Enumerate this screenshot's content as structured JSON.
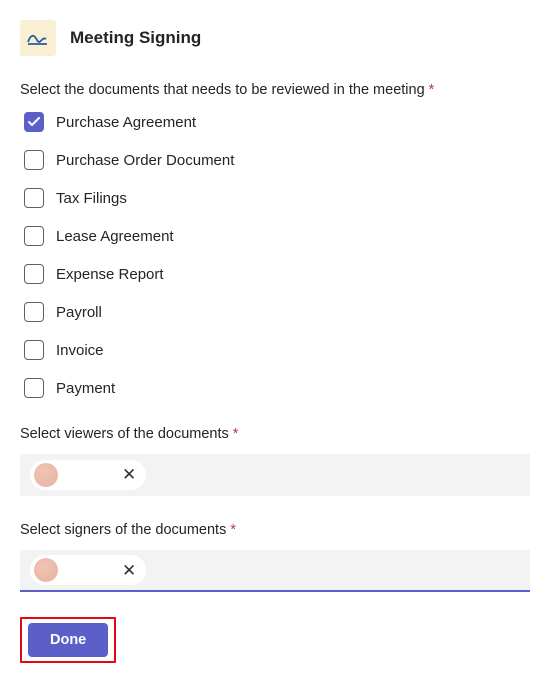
{
  "header": {
    "title": "Meeting Signing"
  },
  "documents": {
    "prompt": "Select the documents that needs to be reviewed in the meeting",
    "options": [
      {
        "label": "Purchase Agreement",
        "checked": true
      },
      {
        "label": "Purchase Order Document",
        "checked": false
      },
      {
        "label": "Tax Filings",
        "checked": false
      },
      {
        "label": "Lease Agreement",
        "checked": false
      },
      {
        "label": "Expense Report",
        "checked": false
      },
      {
        "label": "Payroll",
        "checked": false
      },
      {
        "label": "Invoice",
        "checked": false
      },
      {
        "label": "Payment",
        "checked": false
      }
    ]
  },
  "viewers": {
    "prompt": "Select viewers of the documents"
  },
  "signers": {
    "prompt": "Select signers of the documents"
  },
  "buttons": {
    "done": "Done"
  },
  "required_mark": " *"
}
